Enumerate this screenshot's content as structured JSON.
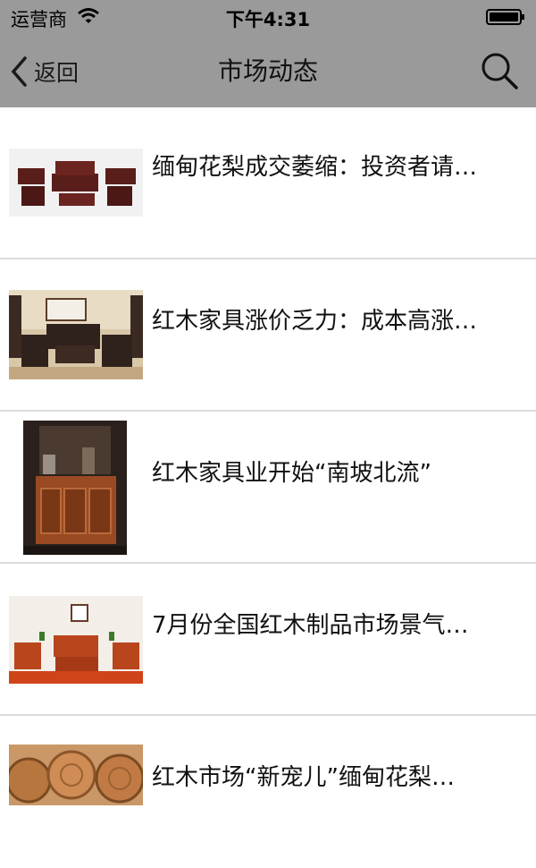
{
  "status": {
    "carrier": "运营商",
    "time": "下午4:31"
  },
  "nav": {
    "back_label": "返回",
    "title": "市场动态"
  },
  "icons": {
    "back": "chevron-left-icon",
    "search": "search-icon",
    "wifi": "wifi-icon",
    "battery": "battery-icon"
  },
  "colors": {
    "header_bg": "#9a9a9a",
    "divider": "#dcdcdc"
  },
  "articles": [
    {
      "title": "缅甸花梨成交萎缩：投资者请…"
    },
    {
      "title": "红木家具涨价乏力：成本高涨…"
    },
    {
      "title": "红木家具业开始“南坡北流”"
    },
    {
      "title": "7月份全国红木制品市场景气…"
    },
    {
      "title": "红木市场“新宠儿”缅甸花梨…"
    }
  ]
}
